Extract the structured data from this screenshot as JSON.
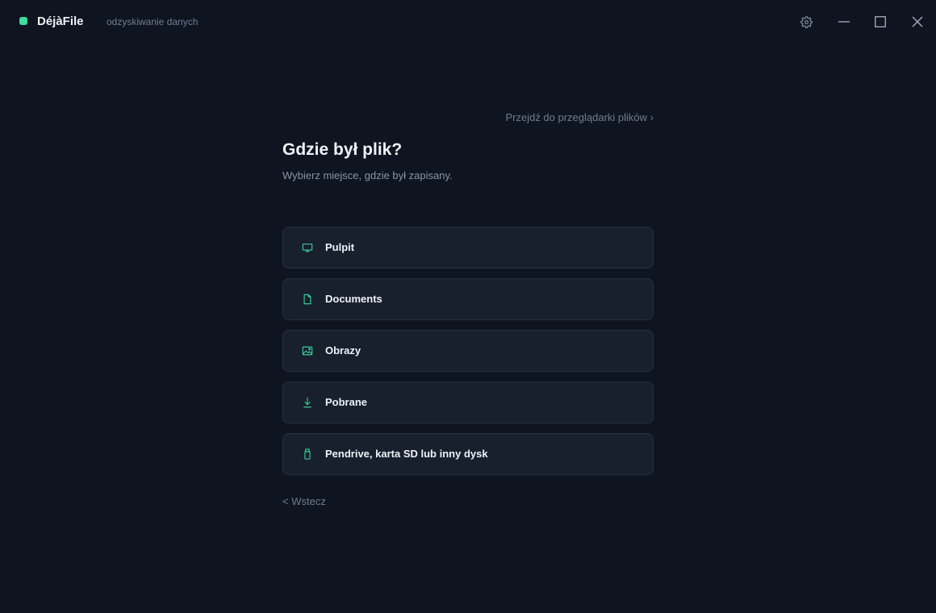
{
  "app": {
    "name": "DéjàFile",
    "subtitle": "odzyskiwanie danych",
    "accent_color": "#3ddc9f"
  },
  "titlebar": {
    "icons": [
      "gear-icon",
      "minimize-icon",
      "maximize-icon",
      "close-icon"
    ]
  },
  "main": {
    "file_browser_link": "Przejdź do przeglądarki plików ›",
    "title": "Gdzie był plik?",
    "subtitle": "Wybierz miejsce, gdzie był zapisany.",
    "locations": [
      {
        "label": "Pulpit",
        "icon": "monitor-icon"
      },
      {
        "label": "Documents",
        "icon": "document-icon"
      },
      {
        "label": "Obrazy",
        "icon": "image-icon"
      },
      {
        "label": "Pobrane",
        "icon": "download-icon"
      },
      {
        "label": "Pendrive, karta SD lub inny dysk",
        "icon": "usb-drive-icon"
      }
    ],
    "back_link": "< Wstecz"
  }
}
